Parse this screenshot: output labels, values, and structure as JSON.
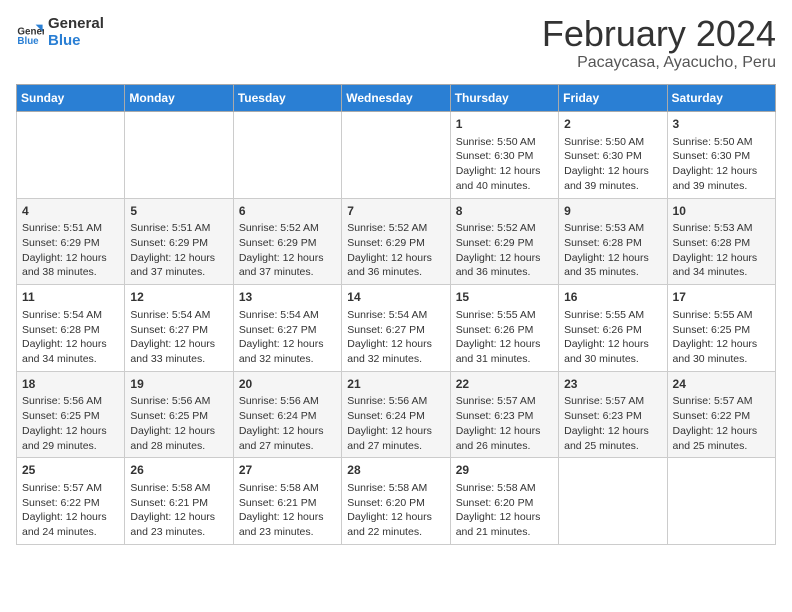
{
  "header": {
    "logo_line1": "General",
    "logo_line2": "Blue",
    "title": "February 2024",
    "subtitle": "Pacaycasa, Ayacucho, Peru"
  },
  "weekdays": [
    "Sunday",
    "Monday",
    "Tuesday",
    "Wednesday",
    "Thursday",
    "Friday",
    "Saturday"
  ],
  "weeks": [
    [
      {
        "day": "",
        "info": ""
      },
      {
        "day": "",
        "info": ""
      },
      {
        "day": "",
        "info": ""
      },
      {
        "day": "",
        "info": ""
      },
      {
        "day": "1",
        "info": "Sunrise: 5:50 AM\nSunset: 6:30 PM\nDaylight: 12 hours\nand 40 minutes."
      },
      {
        "day": "2",
        "info": "Sunrise: 5:50 AM\nSunset: 6:30 PM\nDaylight: 12 hours\nand 39 minutes."
      },
      {
        "day": "3",
        "info": "Sunrise: 5:50 AM\nSunset: 6:30 PM\nDaylight: 12 hours\nand 39 minutes."
      }
    ],
    [
      {
        "day": "4",
        "info": "Sunrise: 5:51 AM\nSunset: 6:29 PM\nDaylight: 12 hours\nand 38 minutes."
      },
      {
        "day": "5",
        "info": "Sunrise: 5:51 AM\nSunset: 6:29 PM\nDaylight: 12 hours\nand 37 minutes."
      },
      {
        "day": "6",
        "info": "Sunrise: 5:52 AM\nSunset: 6:29 PM\nDaylight: 12 hours\nand 37 minutes."
      },
      {
        "day": "7",
        "info": "Sunrise: 5:52 AM\nSunset: 6:29 PM\nDaylight: 12 hours\nand 36 minutes."
      },
      {
        "day": "8",
        "info": "Sunrise: 5:52 AM\nSunset: 6:29 PM\nDaylight: 12 hours\nand 36 minutes."
      },
      {
        "day": "9",
        "info": "Sunrise: 5:53 AM\nSunset: 6:28 PM\nDaylight: 12 hours\nand 35 minutes."
      },
      {
        "day": "10",
        "info": "Sunrise: 5:53 AM\nSunset: 6:28 PM\nDaylight: 12 hours\nand 34 minutes."
      }
    ],
    [
      {
        "day": "11",
        "info": "Sunrise: 5:54 AM\nSunset: 6:28 PM\nDaylight: 12 hours\nand 34 minutes."
      },
      {
        "day": "12",
        "info": "Sunrise: 5:54 AM\nSunset: 6:27 PM\nDaylight: 12 hours\nand 33 minutes."
      },
      {
        "day": "13",
        "info": "Sunrise: 5:54 AM\nSunset: 6:27 PM\nDaylight: 12 hours\nand 32 minutes."
      },
      {
        "day": "14",
        "info": "Sunrise: 5:54 AM\nSunset: 6:27 PM\nDaylight: 12 hours\nand 32 minutes."
      },
      {
        "day": "15",
        "info": "Sunrise: 5:55 AM\nSunset: 6:26 PM\nDaylight: 12 hours\nand 31 minutes."
      },
      {
        "day": "16",
        "info": "Sunrise: 5:55 AM\nSunset: 6:26 PM\nDaylight: 12 hours\nand 30 minutes."
      },
      {
        "day": "17",
        "info": "Sunrise: 5:55 AM\nSunset: 6:25 PM\nDaylight: 12 hours\nand 30 minutes."
      }
    ],
    [
      {
        "day": "18",
        "info": "Sunrise: 5:56 AM\nSunset: 6:25 PM\nDaylight: 12 hours\nand 29 minutes."
      },
      {
        "day": "19",
        "info": "Sunrise: 5:56 AM\nSunset: 6:25 PM\nDaylight: 12 hours\nand 28 minutes."
      },
      {
        "day": "20",
        "info": "Sunrise: 5:56 AM\nSunset: 6:24 PM\nDaylight: 12 hours\nand 27 minutes."
      },
      {
        "day": "21",
        "info": "Sunrise: 5:56 AM\nSunset: 6:24 PM\nDaylight: 12 hours\nand 27 minutes."
      },
      {
        "day": "22",
        "info": "Sunrise: 5:57 AM\nSunset: 6:23 PM\nDaylight: 12 hours\nand 26 minutes."
      },
      {
        "day": "23",
        "info": "Sunrise: 5:57 AM\nSunset: 6:23 PM\nDaylight: 12 hours\nand 25 minutes."
      },
      {
        "day": "24",
        "info": "Sunrise: 5:57 AM\nSunset: 6:22 PM\nDaylight: 12 hours\nand 25 minutes."
      }
    ],
    [
      {
        "day": "25",
        "info": "Sunrise: 5:57 AM\nSunset: 6:22 PM\nDaylight: 12 hours\nand 24 minutes."
      },
      {
        "day": "26",
        "info": "Sunrise: 5:58 AM\nSunset: 6:21 PM\nDaylight: 12 hours\nand 23 minutes."
      },
      {
        "day": "27",
        "info": "Sunrise: 5:58 AM\nSunset: 6:21 PM\nDaylight: 12 hours\nand 23 minutes."
      },
      {
        "day": "28",
        "info": "Sunrise: 5:58 AM\nSunset: 6:20 PM\nDaylight: 12 hours\nand 22 minutes."
      },
      {
        "day": "29",
        "info": "Sunrise: 5:58 AM\nSunset: 6:20 PM\nDaylight: 12 hours\nand 21 minutes."
      },
      {
        "day": "",
        "info": ""
      },
      {
        "day": "",
        "info": ""
      }
    ]
  ]
}
